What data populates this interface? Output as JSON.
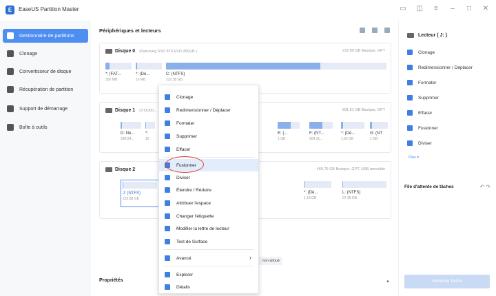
{
  "app": {
    "title": "EaseUS Partition Master",
    "logo": "EaseUS"
  },
  "window": {
    "icons": [
      "bookmark-icon",
      "feedback-icon",
      "menu-icon",
      "minimize-icon",
      "maximize-icon",
      "close-icon"
    ]
  },
  "sidebar": {
    "items": [
      {
        "label": "Gestionnaire de partitions",
        "icon": "partition-icon",
        "active": true
      },
      {
        "label": "Clonage",
        "icon": "clone-icon"
      },
      {
        "label": "Convertisseur de disque",
        "icon": "convert-icon"
      },
      {
        "label": "Récupération de partition",
        "icon": "recovery-icon"
      },
      {
        "label": "Support de démarrage",
        "icon": "bootable-icon"
      },
      {
        "label": "Boîte à outils",
        "icon": "toolbox-icon"
      }
    ]
  },
  "main": {
    "section_title": "Périphériques et lecteurs",
    "properties_label": "Propriétés",
    "unallocated_tab": "non alloué",
    "disks": [
      {
        "name": "Disque 0",
        "model": "(Samsung SSD 870 EVO 250GB )",
        "meta": "232.89 GB Basique, GPT",
        "partitions": [
          {
            "name": "*: (FAT...",
            "size": "300 MB",
            "fill": 0.15
          },
          {
            "name": "*: (Dé...",
            "size": "16 MB",
            "fill": 0.05
          },
          {
            "name": "C: (NTFS)",
            "size": "232.58 GB",
            "fill": 0.7
          }
        ]
      },
      {
        "name": "Disque 1",
        "model": "(ST1000...",
        "meta": "931.51 GB Basique, GPT",
        "partitions": [
          {
            "name": "D: Ne...",
            "size": "596.84...",
            "fill": 0.05
          },
          {
            "name": "*:",
            "size": "16",
            "fill": 0.05
          },
          {
            "name": "E: (...",
            "size": "1 GB",
            "fill": 0.6
          },
          {
            "name": "F: (NT...",
            "size": "904.31...",
            "fill": 0.55
          },
          {
            "name": "*: (Dé...",
            "size": "1.92 GB",
            "fill": 0.1
          },
          {
            "name": "G: (NT",
            "size": "1 GB",
            "fill": 0.1
          }
        ]
      },
      {
        "name": "Disque 2",
        "model": "",
        "meta": "465.76 GB Basique, GPT, USB amovible",
        "partitions": [
          {
            "name": "J: (NTFS)",
            "size": "232.88 GB",
            "fill": 0.02
          },
          {
            "name": "*: (Dé...",
            "size": "1.19 GB",
            "fill": 0.02
          },
          {
            "name": "L: (NTFS)",
            "size": "97.35 GB",
            "fill": 0.02
          }
        ]
      }
    ]
  },
  "context_menu": {
    "items": [
      {
        "label": "Clonage",
        "icon": "clone-icon"
      },
      {
        "label": "Redimensionner / Déplacer",
        "icon": "resize-icon"
      },
      {
        "label": "Formater",
        "icon": "format-icon"
      },
      {
        "label": "Supprimer",
        "icon": "delete-icon"
      },
      {
        "label": "Effacer",
        "icon": "wipe-icon"
      },
      {
        "label": "Fusionner",
        "icon": "merge-icon",
        "highlighted": true
      },
      {
        "label": "Diviser",
        "icon": "split-icon"
      },
      {
        "label": "Étendre / Réduire",
        "icon": "extend-icon"
      },
      {
        "label": "Attribuer l'espace",
        "icon": "allocate-icon"
      },
      {
        "label": "Changer l'étiquette",
        "icon": "label-icon"
      },
      {
        "label": "Modifier la lettre de lecteur",
        "icon": "drive-letter-icon"
      },
      {
        "label": "Test de Surface",
        "icon": "surface-test-icon"
      },
      {
        "label": "Avancé",
        "icon": "advanced-icon",
        "submenu": true
      },
      {
        "label": "Explorer",
        "icon": "explore-icon"
      },
      {
        "label": "Détails",
        "icon": "details-icon"
      }
    ]
  },
  "right_panel": {
    "title": "Lecteur ( J: )",
    "actions": [
      {
        "label": "Clonage",
        "icon": "clone-icon"
      },
      {
        "label": "Redimensionner / Déplacer",
        "icon": "resize-icon"
      },
      {
        "label": "Formater",
        "icon": "format-icon"
      },
      {
        "label": "Supprimer",
        "icon": "delete-icon"
      },
      {
        "label": "Effacer",
        "icon": "wipe-icon"
      },
      {
        "label": "Fusionner",
        "icon": "merge-icon"
      },
      {
        "label": "Diviser",
        "icon": "split-icon"
      }
    ],
    "more": "Plus",
    "queue_title": "File d'attente de tâches",
    "execute_button": "Exécuter tâche"
  },
  "colors": {
    "accent": "#4d8ef0",
    "partition_fill": "#8ab0ec",
    "annotation": "#d9452e"
  }
}
